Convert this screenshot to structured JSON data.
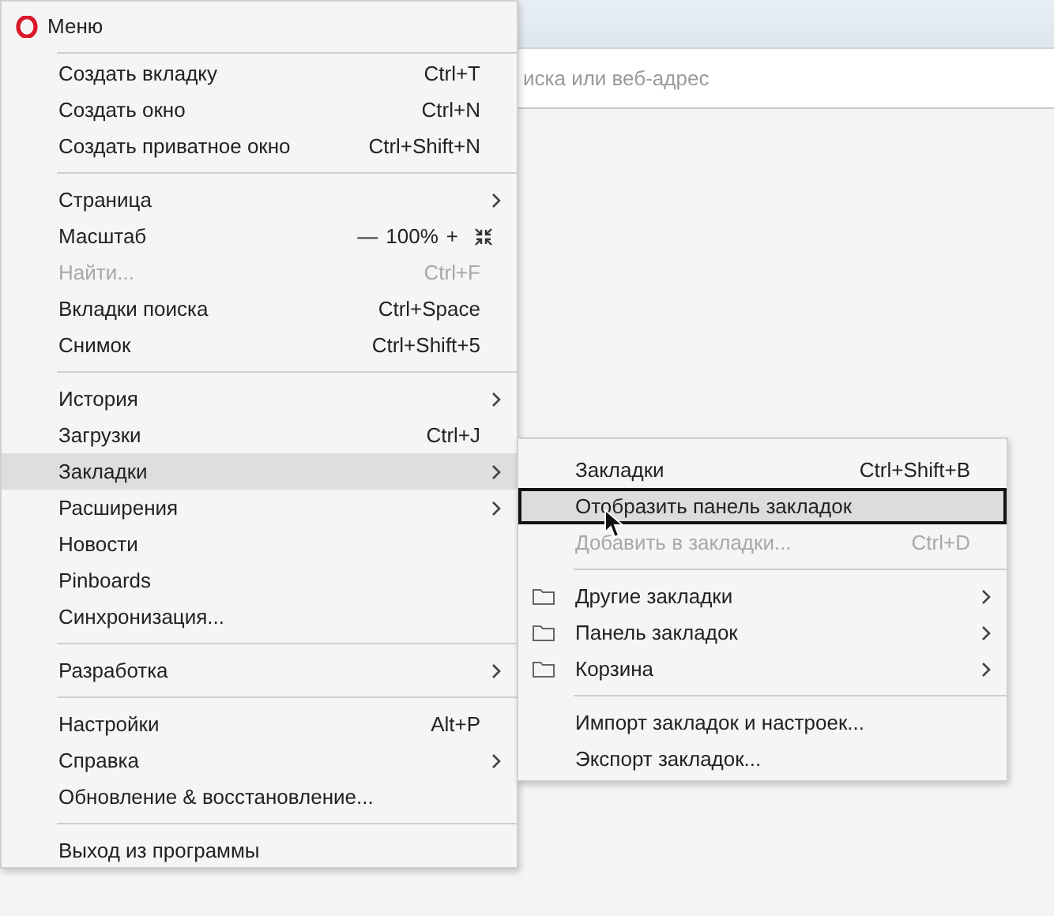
{
  "address_bar": {
    "placeholder": "иска или веб-адрес"
  },
  "menu": {
    "title": "Меню",
    "groups": [
      [
        {
          "kind": "item",
          "label": "Создать вкладку",
          "shortcut": "Ctrl+T",
          "submenu": false,
          "disabled": false,
          "selected": false
        },
        {
          "kind": "item",
          "label": "Создать окно",
          "shortcut": "Ctrl+N",
          "submenu": false,
          "disabled": false,
          "selected": false
        },
        {
          "kind": "item",
          "label": "Создать приватное окно",
          "shortcut": "Ctrl+Shift+N",
          "submenu": false,
          "disabled": false,
          "selected": false
        }
      ],
      [
        {
          "kind": "item",
          "label": "Страница",
          "submenu": true,
          "disabled": false,
          "selected": false
        },
        {
          "kind": "zoom",
          "label": "Масштаб",
          "minus": "—",
          "value": "100%",
          "plus": "+",
          "disabled": false,
          "selected": false
        },
        {
          "kind": "item",
          "label": "Найти...",
          "shortcut": "Ctrl+F",
          "submenu": false,
          "disabled": true,
          "selected": false
        },
        {
          "kind": "item",
          "label": "Вкладки поиска",
          "shortcut": "Ctrl+Space",
          "submenu": false,
          "disabled": false,
          "selected": false
        },
        {
          "kind": "item",
          "label": "Снимок",
          "shortcut": "Ctrl+Shift+5",
          "submenu": false,
          "disabled": false,
          "selected": false
        }
      ],
      [
        {
          "kind": "item",
          "label": "История",
          "submenu": true,
          "disabled": false,
          "selected": false
        },
        {
          "kind": "item",
          "label": "Загрузки",
          "shortcut": "Ctrl+J",
          "submenu": false,
          "disabled": false,
          "selected": false
        },
        {
          "kind": "item",
          "label": "Закладки",
          "submenu": true,
          "disabled": false,
          "selected": true
        },
        {
          "kind": "item",
          "label": "Расширения",
          "submenu": true,
          "disabled": false,
          "selected": false
        },
        {
          "kind": "item",
          "label": "Новости",
          "submenu": false,
          "disabled": false,
          "selected": false
        },
        {
          "kind": "item",
          "label": "Pinboards",
          "submenu": false,
          "disabled": false,
          "selected": false
        },
        {
          "kind": "item",
          "label": "Синхронизация...",
          "submenu": false,
          "disabled": false,
          "selected": false
        }
      ],
      [
        {
          "kind": "item",
          "label": "Разработка",
          "submenu": true,
          "disabled": false,
          "selected": false
        }
      ],
      [
        {
          "kind": "item",
          "label": "Настройки",
          "shortcut": "Alt+P",
          "submenu": false,
          "disabled": false,
          "selected": false
        },
        {
          "kind": "item",
          "label": "Справка",
          "submenu": true,
          "disabled": false,
          "selected": false
        },
        {
          "kind": "item",
          "label": "Обновление & восстановление...",
          "submenu": false,
          "disabled": false,
          "selected": false
        }
      ],
      [
        {
          "kind": "item",
          "label": "Выход из программы",
          "submenu": false,
          "disabled": false,
          "selected": false
        }
      ]
    ]
  },
  "bookmarks_submenu": {
    "groups": [
      [
        {
          "kind": "item",
          "label": "Закладки",
          "shortcut": "Ctrl+Shift+B",
          "submenu": false,
          "disabled": false,
          "selected": false
        },
        {
          "kind": "item",
          "label": "Отобразить панель закладок",
          "submenu": false,
          "disabled": false,
          "selected": true
        },
        {
          "kind": "item",
          "label": "Добавить в закладки...",
          "shortcut": "Ctrl+D",
          "submenu": false,
          "disabled": true,
          "selected": false
        }
      ],
      [
        {
          "kind": "folder",
          "label": "Другие закладки",
          "submenu": true,
          "disabled": false,
          "selected": false
        },
        {
          "kind": "folder",
          "label": "Панель закладок",
          "submenu": true,
          "disabled": false,
          "selected": false
        },
        {
          "kind": "folder",
          "label": "Корзина",
          "submenu": true,
          "disabled": false,
          "selected": false
        }
      ],
      [
        {
          "kind": "item",
          "label": "Импорт закладок и настроек...",
          "submenu": false,
          "disabled": false,
          "selected": false
        },
        {
          "kind": "item",
          "label": "Экспорт закладок...",
          "submenu": false,
          "disabled": false,
          "selected": false
        }
      ]
    ]
  }
}
